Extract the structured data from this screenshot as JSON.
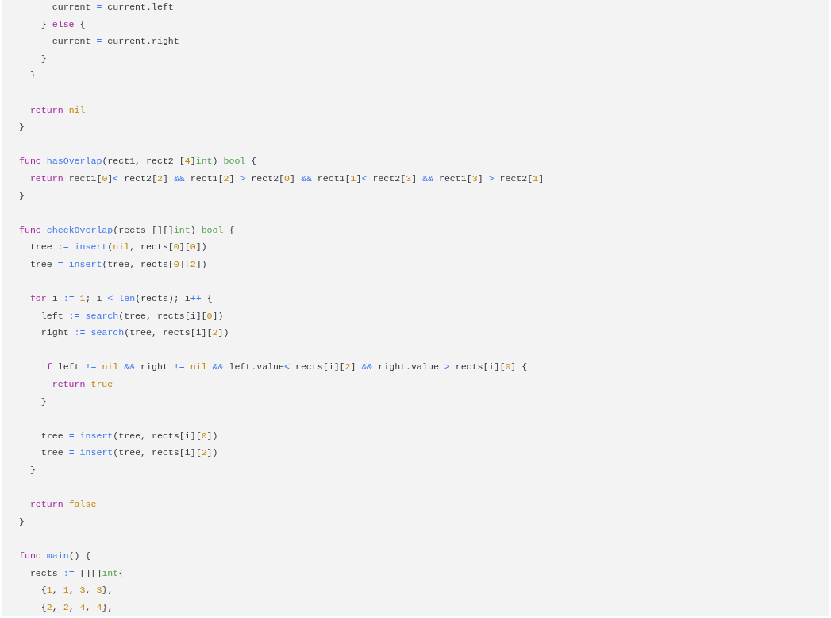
{
  "code_lines": [
    {
      "kind": "code",
      "tokens": [
        {
          "text": "      current ",
          "kind": "plain"
        },
        {
          "text": "=",
          "kind": "op"
        },
        {
          "text": " current.left",
          "kind": "plain"
        }
      ]
    },
    {
      "kind": "code",
      "tokens": [
        {
          "text": "    } ",
          "kind": "plain"
        },
        {
          "text": "else",
          "kind": "kw"
        },
        {
          "text": " {",
          "kind": "plain"
        }
      ]
    },
    {
      "kind": "code",
      "tokens": [
        {
          "text": "      current ",
          "kind": "plain"
        },
        {
          "text": "=",
          "kind": "op"
        },
        {
          "text": " current.right",
          "kind": "plain"
        }
      ]
    },
    {
      "kind": "code",
      "tokens": [
        {
          "text": "    }",
          "kind": "plain"
        }
      ]
    },
    {
      "kind": "code",
      "tokens": [
        {
          "text": "  }",
          "kind": "plain"
        }
      ]
    },
    {
      "kind": "blank"
    },
    {
      "kind": "code",
      "tokens": [
        {
          "text": "  return",
          "kind": "kw"
        },
        {
          "text": " nil",
          "kind": "num"
        }
      ]
    },
    {
      "kind": "code",
      "tokens": [
        {
          "text": "}",
          "kind": "plain"
        }
      ]
    },
    {
      "kind": "blank"
    },
    {
      "kind": "code",
      "tokens": [
        {
          "text": "func",
          "kind": "kw"
        },
        {
          "text": " hasOverlap",
          "kind": "fn"
        },
        {
          "text": "(rect1, rect2 [",
          "kind": "plain"
        },
        {
          "text": "4",
          "kind": "num"
        },
        {
          "text": "]",
          "kind": "plain"
        },
        {
          "text": "int",
          "kind": "type"
        },
        {
          "text": ") ",
          "kind": "plain"
        },
        {
          "text": "bool",
          "kind": "type"
        },
        {
          "text": " {",
          "kind": "plain"
        }
      ]
    },
    {
      "kind": "code",
      "tokens": [
        {
          "text": "  return",
          "kind": "kw"
        },
        {
          "text": " rect1[",
          "kind": "plain"
        },
        {
          "text": "0",
          "kind": "num"
        },
        {
          "text": "]",
          "kind": "plain"
        },
        {
          "text": "<",
          "kind": "op"
        },
        {
          "text": " rect2[",
          "kind": "plain"
        },
        {
          "text": "2",
          "kind": "num"
        },
        {
          "text": "] ",
          "kind": "plain"
        },
        {
          "text": "&&",
          "kind": "op"
        },
        {
          "text": " rect1[",
          "kind": "plain"
        },
        {
          "text": "2",
          "kind": "num"
        },
        {
          "text": "] ",
          "kind": "plain"
        },
        {
          "text": ">",
          "kind": "op"
        },
        {
          "text": " rect2[",
          "kind": "plain"
        },
        {
          "text": "0",
          "kind": "num"
        },
        {
          "text": "] ",
          "kind": "plain"
        },
        {
          "text": "&&",
          "kind": "op"
        },
        {
          "text": " rect1[",
          "kind": "plain"
        },
        {
          "text": "1",
          "kind": "num"
        },
        {
          "text": "]",
          "kind": "plain"
        },
        {
          "text": "<",
          "kind": "op"
        },
        {
          "text": " rect2[",
          "kind": "plain"
        },
        {
          "text": "3",
          "kind": "num"
        },
        {
          "text": "] ",
          "kind": "plain"
        },
        {
          "text": "&&",
          "kind": "op"
        },
        {
          "text": " rect1[",
          "kind": "plain"
        },
        {
          "text": "3",
          "kind": "num"
        },
        {
          "text": "] ",
          "kind": "plain"
        },
        {
          "text": ">",
          "kind": "op"
        },
        {
          "text": " rect2[",
          "kind": "plain"
        },
        {
          "text": "1",
          "kind": "num"
        },
        {
          "text": "]",
          "kind": "plain"
        }
      ]
    },
    {
      "kind": "code",
      "tokens": [
        {
          "text": "}",
          "kind": "plain"
        }
      ]
    },
    {
      "kind": "blank"
    },
    {
      "kind": "code",
      "tokens": [
        {
          "text": "func",
          "kind": "kw"
        },
        {
          "text": " checkOverlap",
          "kind": "fn"
        },
        {
          "text": "(rects [][]",
          "kind": "plain"
        },
        {
          "text": "int",
          "kind": "type"
        },
        {
          "text": ") ",
          "kind": "plain"
        },
        {
          "text": "bool",
          "kind": "type"
        },
        {
          "text": " {",
          "kind": "plain"
        }
      ]
    },
    {
      "kind": "code",
      "tokens": [
        {
          "text": "  tree ",
          "kind": "plain"
        },
        {
          "text": ":=",
          "kind": "op"
        },
        {
          "text": " insert",
          "kind": "fn"
        },
        {
          "text": "(",
          "kind": "plain"
        },
        {
          "text": "nil",
          "kind": "num"
        },
        {
          "text": ", rects[",
          "kind": "plain"
        },
        {
          "text": "0",
          "kind": "num"
        },
        {
          "text": "][",
          "kind": "plain"
        },
        {
          "text": "0",
          "kind": "num"
        },
        {
          "text": "])",
          "kind": "plain"
        }
      ]
    },
    {
      "kind": "code",
      "tokens": [
        {
          "text": "  tree ",
          "kind": "plain"
        },
        {
          "text": "=",
          "kind": "op"
        },
        {
          "text": " insert",
          "kind": "fn"
        },
        {
          "text": "(tree, rects[",
          "kind": "plain"
        },
        {
          "text": "0",
          "kind": "num"
        },
        {
          "text": "][",
          "kind": "plain"
        },
        {
          "text": "2",
          "kind": "num"
        },
        {
          "text": "])",
          "kind": "plain"
        }
      ]
    },
    {
      "kind": "blank"
    },
    {
      "kind": "code",
      "tokens": [
        {
          "text": "  for",
          "kind": "kw"
        },
        {
          "text": " i ",
          "kind": "plain"
        },
        {
          "text": ":=",
          "kind": "op"
        },
        {
          "text": " 1",
          "kind": "num"
        },
        {
          "text": "; i ",
          "kind": "plain"
        },
        {
          "text": "<",
          "kind": "op"
        },
        {
          "text": " len",
          "kind": "fn"
        },
        {
          "text": "(rects); i",
          "kind": "plain"
        },
        {
          "text": "++",
          "kind": "op"
        },
        {
          "text": " {",
          "kind": "plain"
        }
      ]
    },
    {
      "kind": "code",
      "tokens": [
        {
          "text": "    left ",
          "kind": "plain"
        },
        {
          "text": ":=",
          "kind": "op"
        },
        {
          "text": " search",
          "kind": "fn"
        },
        {
          "text": "(tree, rects[i][",
          "kind": "plain"
        },
        {
          "text": "0",
          "kind": "num"
        },
        {
          "text": "])",
          "kind": "plain"
        }
      ]
    },
    {
      "kind": "code",
      "tokens": [
        {
          "text": "    right ",
          "kind": "plain"
        },
        {
          "text": ":=",
          "kind": "op"
        },
        {
          "text": " search",
          "kind": "fn"
        },
        {
          "text": "(tree, rects[i][",
          "kind": "plain"
        },
        {
          "text": "2",
          "kind": "num"
        },
        {
          "text": "])",
          "kind": "plain"
        }
      ]
    },
    {
      "kind": "blank"
    },
    {
      "kind": "code",
      "tokens": [
        {
          "text": "    if",
          "kind": "kw"
        },
        {
          "text": " left ",
          "kind": "plain"
        },
        {
          "text": "!=",
          "kind": "op"
        },
        {
          "text": " nil",
          "kind": "num"
        },
        {
          "text": " &&",
          "kind": "op"
        },
        {
          "text": " right ",
          "kind": "plain"
        },
        {
          "text": "!=",
          "kind": "op"
        },
        {
          "text": " nil",
          "kind": "num"
        },
        {
          "text": " &&",
          "kind": "op"
        },
        {
          "text": " left.value",
          "kind": "plain"
        },
        {
          "text": "<",
          "kind": "op"
        },
        {
          "text": " rects[i][",
          "kind": "plain"
        },
        {
          "text": "2",
          "kind": "num"
        },
        {
          "text": "] ",
          "kind": "plain"
        },
        {
          "text": "&&",
          "kind": "op"
        },
        {
          "text": " right.value ",
          "kind": "plain"
        },
        {
          "text": ">",
          "kind": "op"
        },
        {
          "text": " rects[i][",
          "kind": "plain"
        },
        {
          "text": "0",
          "kind": "num"
        },
        {
          "text": "] {",
          "kind": "plain"
        }
      ]
    },
    {
      "kind": "code",
      "tokens": [
        {
          "text": "      return",
          "kind": "kw"
        },
        {
          "text": " true",
          "kind": "num"
        }
      ]
    },
    {
      "kind": "code",
      "tokens": [
        {
          "text": "    }",
          "kind": "plain"
        }
      ]
    },
    {
      "kind": "blank"
    },
    {
      "kind": "code",
      "tokens": [
        {
          "text": "    tree ",
          "kind": "plain"
        },
        {
          "text": "=",
          "kind": "op"
        },
        {
          "text": " insert",
          "kind": "fn"
        },
        {
          "text": "(tree, rects[i][",
          "kind": "plain"
        },
        {
          "text": "0",
          "kind": "num"
        },
        {
          "text": "])",
          "kind": "plain"
        }
      ]
    },
    {
      "kind": "code",
      "tokens": [
        {
          "text": "    tree ",
          "kind": "plain"
        },
        {
          "text": "=",
          "kind": "op"
        },
        {
          "text": " insert",
          "kind": "fn"
        },
        {
          "text": "(tree, rects[i][",
          "kind": "plain"
        },
        {
          "text": "2",
          "kind": "num"
        },
        {
          "text": "])",
          "kind": "plain"
        }
      ]
    },
    {
      "kind": "code",
      "tokens": [
        {
          "text": "  }",
          "kind": "plain"
        }
      ]
    },
    {
      "kind": "blank"
    },
    {
      "kind": "code",
      "tokens": [
        {
          "text": "  return",
          "kind": "kw"
        },
        {
          "text": " false",
          "kind": "num"
        }
      ]
    },
    {
      "kind": "code",
      "tokens": [
        {
          "text": "}",
          "kind": "plain"
        }
      ]
    },
    {
      "kind": "blank"
    },
    {
      "kind": "code",
      "tokens": [
        {
          "text": "func",
          "kind": "kw"
        },
        {
          "text": " main",
          "kind": "fn"
        },
        {
          "text": "() {",
          "kind": "plain"
        }
      ]
    },
    {
      "kind": "code",
      "tokens": [
        {
          "text": "  rects ",
          "kind": "plain"
        },
        {
          "text": ":=",
          "kind": "op"
        },
        {
          "text": " [][]",
          "kind": "plain"
        },
        {
          "text": "int",
          "kind": "type"
        },
        {
          "text": "{",
          "kind": "plain"
        }
      ]
    },
    {
      "kind": "code",
      "tokens": [
        {
          "text": "    {",
          "kind": "plain"
        },
        {
          "text": "1",
          "kind": "num"
        },
        {
          "text": ", ",
          "kind": "plain"
        },
        {
          "text": "1",
          "kind": "num"
        },
        {
          "text": ", ",
          "kind": "plain"
        },
        {
          "text": "3",
          "kind": "num"
        },
        {
          "text": ", ",
          "kind": "plain"
        },
        {
          "text": "3",
          "kind": "num"
        },
        {
          "text": "},",
          "kind": "plain"
        }
      ]
    },
    {
      "kind": "code",
      "tokens": [
        {
          "text": "    {",
          "kind": "plain"
        },
        {
          "text": "2",
          "kind": "num"
        },
        {
          "text": ", ",
          "kind": "plain"
        },
        {
          "text": "2",
          "kind": "num"
        },
        {
          "text": ", ",
          "kind": "plain"
        },
        {
          "text": "4",
          "kind": "num"
        },
        {
          "text": ", ",
          "kind": "plain"
        },
        {
          "text": "4",
          "kind": "num"
        },
        {
          "text": "},",
          "kind": "plain"
        }
      ]
    }
  ]
}
